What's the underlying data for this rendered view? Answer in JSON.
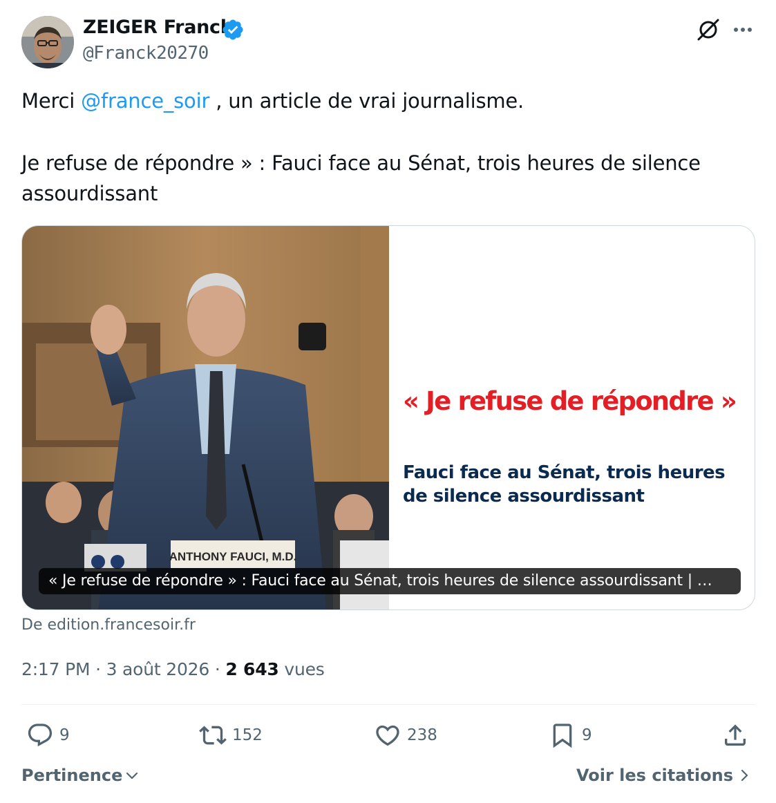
{
  "author": {
    "name": "ZEIGER Franck",
    "handle": "@Franck20270"
  },
  "tweet": {
    "text_before_mention": "Merci ",
    "mention": "@france_soir",
    "text_after_mention": " , un article de vrai journalisme.",
    "paragraph_2": "Je refuse de répondre » : Fauci face au Sénat, trois heures de silence assourdissant"
  },
  "card": {
    "quote": "« Je refuse de répondre »",
    "subtitle": "Fauci face au Sénat, trois heures de silence assourdissant",
    "nameplate": "ANTHONY FAUCI, M.D.",
    "caption": "« Je refuse de répondre » : Fauci face au Sénat, trois heures de silence assourdissant | …",
    "source": "De edition.francesoir.fr"
  },
  "meta": {
    "time": "2:17 PM",
    "separator": " · ",
    "date": "3 août 2026",
    "views_count": "2 643",
    "views_label": " vues"
  },
  "actions": {
    "replies": "9",
    "retweets": "152",
    "likes": "238",
    "bookmarks": "9"
  },
  "footer": {
    "sort_label": "Pertinence",
    "quotes_label": "Voir les citations"
  },
  "colors": {
    "link": "#1d9bf0",
    "secondary_text": "#536471",
    "card_quote": "#e31e24",
    "card_subtitle": "#0a2a4f"
  },
  "icons": [
    "verified-badge-icon",
    "grok-icon",
    "more-icon",
    "reply-icon",
    "retweet-icon",
    "like-icon",
    "bookmark-icon",
    "share-icon",
    "chevron-down-icon",
    "chevron-right-icon"
  ]
}
